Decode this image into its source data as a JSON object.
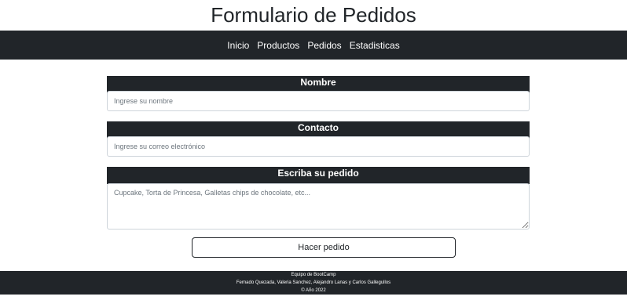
{
  "page": {
    "title": "Formulario de Pedidos"
  },
  "nav": {
    "items": [
      {
        "label": "Inicio"
      },
      {
        "label": "Productos"
      },
      {
        "label": "Pedidos"
      },
      {
        "label": "Estadisticas"
      }
    ]
  },
  "form": {
    "nombre": {
      "label": "Nombre",
      "placeholder": "Ingrese su nombre",
      "value": ""
    },
    "contacto": {
      "label": "Contacto",
      "placeholder": "Ingrese su correo electrónico",
      "value": ""
    },
    "pedido": {
      "label": "Escriba su pedido",
      "placeholder": "Cupcake, Torta de Princesa, Galletas chips de chocolate, etc...",
      "value": ""
    },
    "submit_label": "Hacer pedido"
  },
  "footer": {
    "line1": "Equipo de BootCamp",
    "line2": "Fernado Quezada, Valeria Sanchez, Alejandro Lanas y Carlos Gallegullos",
    "line3": "© Año 2022"
  },
  "colors": {
    "dark": "#212529",
    "background": "#ffffff",
    "text_on_dark": "#ffffff"
  }
}
